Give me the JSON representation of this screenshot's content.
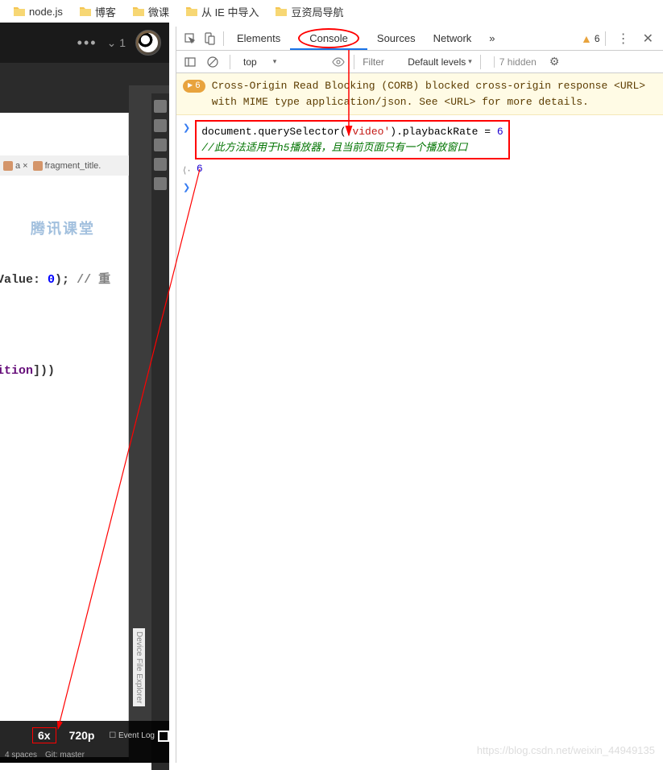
{
  "bookmarks": [
    {
      "label": "node.js"
    },
    {
      "label": "博客"
    },
    {
      "label": "微课"
    },
    {
      "label": "从 IE 中导入"
    },
    {
      "label": "豆资局导航"
    }
  ],
  "leftPanel": {
    "version": "1",
    "dots": "•••",
    "chevron": "⌄"
  },
  "codeEditor": {
    "tab1": "a ×",
    "tab2": "fragment_title.",
    "line1_pre": "aultValue: ",
    "line1_num": "0",
    "line1_post": "); ",
    "line1_cmt": "// 重",
    "line2_pre": "kPosition",
    "line2_post": "]))",
    "watermark": "腾讯课堂"
  },
  "bottomBar": {
    "speed": "6x",
    "quality": "720p",
    "spaces": "4 spaces",
    "git": "Git: master",
    "eventLog": "Event Log",
    "deviceExplorer": "Device File Explorer"
  },
  "devtools": {
    "tabs": {
      "elements": "Elements",
      "console": "Console",
      "sources": "Sources",
      "network": "Network",
      "more": "»"
    },
    "warnCount": "6",
    "toolbar": {
      "context": "top",
      "filterPlaceholder": "Filter",
      "levels": "Default levels",
      "hidden": "7 hidden"
    },
    "warning": {
      "count": "6",
      "text": "Cross-Origin Read Blocking (CORB) blocked cross-origin response <URL> with MIME type application/json. See <URL> for more details."
    },
    "console": {
      "code_pre": "document.querySelector(",
      "code_str": "'video'",
      "code_mid": ").playbackRate = ",
      "code_num": "6",
      "comment": "//此方法适用于h5播放器，且当前页面只有一个播放窗口",
      "result": "6"
    }
  },
  "watermark": "https://blog.csdn.net/weixin_44949135"
}
